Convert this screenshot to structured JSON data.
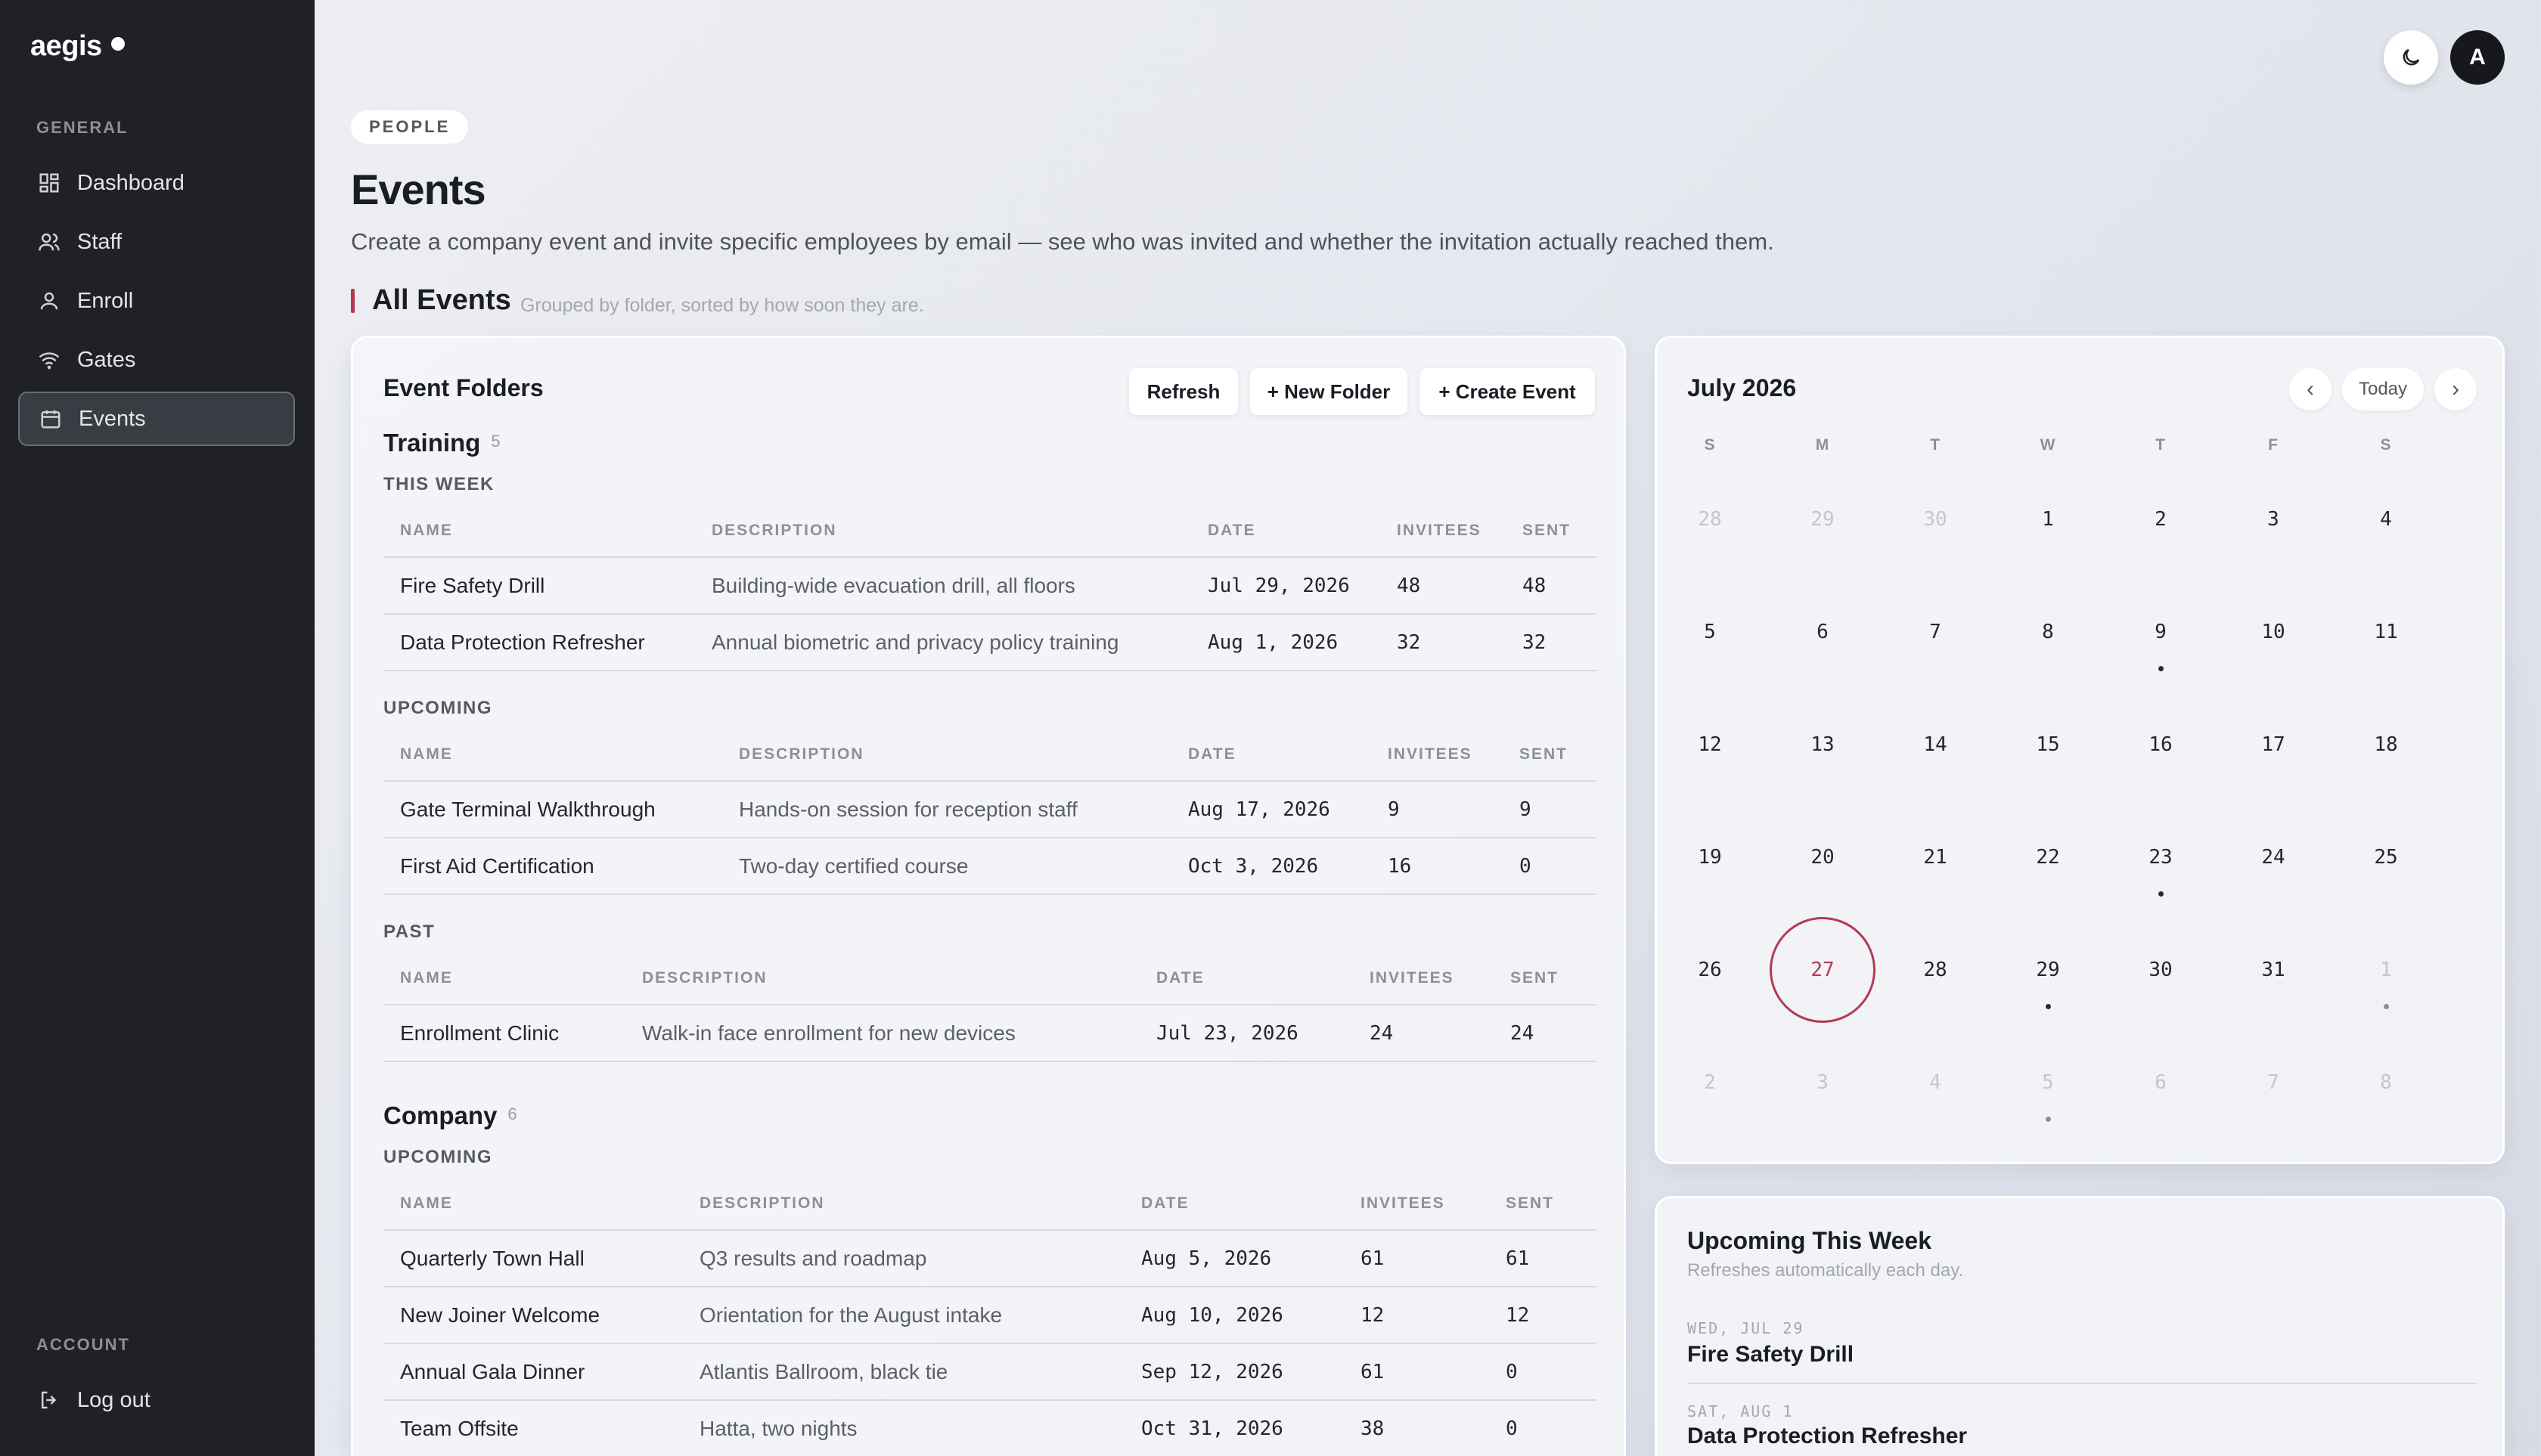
{
  "sidebar": {
    "brand": "aegis",
    "section_general": "GENERAL",
    "items": [
      {
        "label": "Dashboard",
        "icon": "grid-icon"
      },
      {
        "label": "Staff",
        "icon": "users-icon"
      },
      {
        "label": "Enroll",
        "icon": "user-icon"
      },
      {
        "label": "Gates",
        "icon": "wifi-icon"
      },
      {
        "label": "Events",
        "icon": "calendar-icon",
        "active": true
      }
    ],
    "section_account": "ACCOUNT",
    "logout_label": "Log out"
  },
  "topbar": {
    "avatar_initial": "A",
    "theme_icon": "moon-icon"
  },
  "header": {
    "pill": "PEOPLE",
    "title": "Events",
    "subtitle": "Create a company event and invite specific employees by email — see who was invited and whether the invitation actually reached them.",
    "section_title": "All Events",
    "section_hint": "Grouped by folder, sorted by how soon they are."
  },
  "folders_card": {
    "title": "Event Folders",
    "refresh_label": "Refresh",
    "new_folder_label": "+ New Folder",
    "create_event_label": "+ Create Event",
    "columns": [
      "NAME",
      "DESCRIPTION",
      "DATE",
      "INVITEES",
      "SENT"
    ],
    "folders": [
      {
        "name": "Training",
        "count": "5",
        "groups": [
          {
            "label": "THIS WEEK",
            "rows": [
              [
                "Fire Safety Drill",
                "Building-wide evacuation drill, all floors",
                "Jul 29, 2026",
                "48",
                "48"
              ],
              [
                "Data Protection Refresher",
                "Annual biometric and privacy policy training",
                "Aug 1, 2026",
                "32",
                "32"
              ]
            ]
          },
          {
            "label": "UPCOMING",
            "rows": [
              [
                "Gate Terminal Walkthrough",
                "Hands-on session for reception staff",
                "Aug 17, 2026",
                "9",
                "9"
              ],
              [
                "First Aid Certification",
                "Two-day certified course",
                "Oct 3, 2026",
                "16",
                "0"
              ]
            ]
          },
          {
            "label": "PAST",
            "rows": [
              [
                "Enrollment Clinic",
                "Walk-in face enrollment for new devices",
                "Jul 23, 2026",
                "24",
                "24"
              ]
            ]
          }
        ]
      },
      {
        "name": "Company",
        "count": "6",
        "groups": [
          {
            "label": "UPCOMING",
            "rows": [
              [
                "Quarterly Town Hall",
                "Q3 results and roadmap",
                "Aug 5, 2026",
                "61",
                "61"
              ],
              [
                "New Joiner Welcome",
                "Orientation for the August intake",
                "Aug 10, 2026",
                "12",
                "12"
              ],
              [
                "Annual Gala Dinner",
                "Atlantis Ballroom, black tie",
                "Sep 12, 2026",
                "61",
                "0"
              ],
              [
                "Team Offsite",
                "Hatta, two nights",
                "Oct 31, 2026",
                "38",
                "0"
              ]
            ]
          }
        ]
      }
    ]
  },
  "calendar": {
    "month_label": "July 2026",
    "prev_label": "‹",
    "today_label": "Today",
    "next_label": "›",
    "weekdays": [
      "S",
      "M",
      "T",
      "W",
      "T",
      "F",
      "S"
    ],
    "weeks": [
      [
        {
          "d": "28",
          "m": true
        },
        {
          "d": "29",
          "m": true
        },
        {
          "d": "30",
          "m": true
        },
        {
          "d": "1"
        },
        {
          "d": "2"
        },
        {
          "d": "3"
        },
        {
          "d": "4"
        }
      ],
      [
        {
          "d": "5"
        },
        {
          "d": "6"
        },
        {
          "d": "7"
        },
        {
          "d": "8"
        },
        {
          "d": "9",
          "dot": true
        },
        {
          "d": "10"
        },
        {
          "d": "11"
        }
      ],
      [
        {
          "d": "12"
        },
        {
          "d": "13"
        },
        {
          "d": "14"
        },
        {
          "d": "15"
        },
        {
          "d": "16"
        },
        {
          "d": "17"
        },
        {
          "d": "18"
        }
      ],
      [
        {
          "d": "19"
        },
        {
          "d": "20"
        },
        {
          "d": "21"
        },
        {
          "d": "22"
        },
        {
          "d": "23",
          "dot": true
        },
        {
          "d": "24"
        },
        {
          "d": "25"
        }
      ],
      [
        {
          "d": "26"
        },
        {
          "d": "27",
          "today": true
        },
        {
          "d": "28"
        },
        {
          "d": "29",
          "dot": true
        },
        {
          "d": "30"
        },
        {
          "d": "31"
        },
        {
          "d": "1",
          "m": true,
          "dot": true
        }
      ],
      [
        {
          "d": "2",
          "m": true
        },
        {
          "d": "3",
          "m": true
        },
        {
          "d": "4",
          "m": true
        },
        {
          "d": "5",
          "m": true,
          "dot": true
        },
        {
          "d": "6",
          "m": true
        },
        {
          "d": "7",
          "m": true
        },
        {
          "d": "8",
          "m": true
        }
      ]
    ]
  },
  "upcoming_card": {
    "title": "Upcoming This Week",
    "subtitle": "Refreshes automatically each day.",
    "items": [
      {
        "date": "WED, JUL 29",
        "name": "Fire Safety Drill"
      },
      {
        "date": "SAT, AUG 1",
        "name": "Data Protection Refresher"
      }
    ]
  },
  "colors": {
    "accent": "#b33a55",
    "sidebar_bg": "#1f2126"
  }
}
